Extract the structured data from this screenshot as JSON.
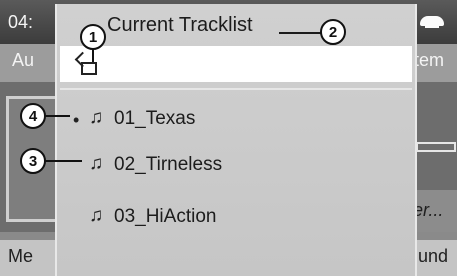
{
  "header": {
    "time": "04:",
    "title": "Current Tracklist",
    "phone_icon": "phone-icon"
  },
  "background": {
    "left_label_top": "Au",
    "right_label_top": "tem",
    "right_label_mid": "er...",
    "left_label_bottom": "Me",
    "right_label_bottom": "und"
  },
  "path": {
    "icon": "folder-up-icon"
  },
  "tracks": [
    {
      "name": "01_Texas",
      "note": "♫",
      "bullet": "•"
    },
    {
      "name": "02_Tirneless",
      "note": "♫",
      "bullet": ""
    },
    {
      "name": "03_HiAction",
      "note": "♫",
      "bullet": ""
    }
  ],
  "callouts": [
    "1",
    "2",
    "3",
    "4"
  ]
}
